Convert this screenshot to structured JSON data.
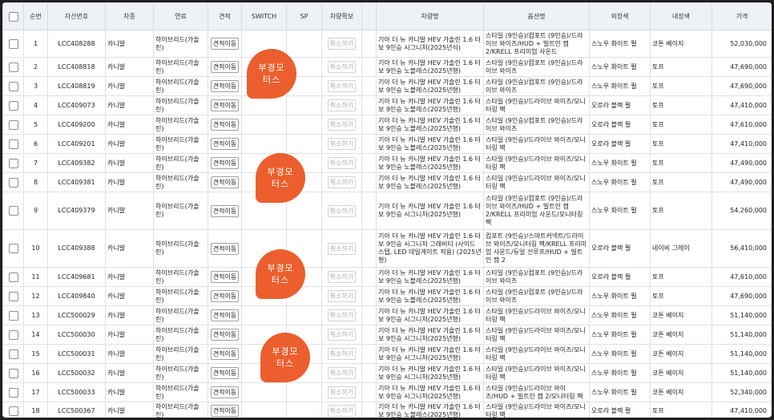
{
  "headers": [
    "",
    "순번",
    "자산번호",
    "차종",
    "연료",
    "견적",
    "SWITCH",
    "SP",
    "차량확보",
    "",
    "차량명",
    "옵션명",
    "외장색",
    "내장색",
    "가격"
  ],
  "buttons": {
    "quote_move": "견적이동",
    "cancel": "취소하기"
  },
  "badge": {
    "line1": "부경모",
    "line2": "터스"
  },
  "rows": [
    {
      "no": "1",
      "asset": "LCC408288",
      "model": "카니발",
      "fuel": "하이브리드(가솔린)",
      "name": "기아 더 뉴 카니발 HEV 가솔린 1.6 터보 9인승 시그니처(2025년식)",
      "option": "스타일 (9인승)/컴포트 (9인승)/드라이브 와이즈/HUD + 빌트인 캠 2/KRELL 프리미엄 사운드",
      "ext": "스노우 화이트 펄",
      "int": "코튼 베이지",
      "price": "52,030,000",
      "h": 34
    },
    {
      "no": "2",
      "asset": "LCC408818",
      "model": "카니발",
      "fuel": "하이브리드(가솔린)",
      "name": "기아 더 뉴 카니발 HEV 가솔린 1.6 터보 9인승 노블레스(2025년형)",
      "option": "스타일 (9인승)/컴포트 (9인승)/드라이브 와이즈",
      "ext": "스노우 화이트 펄",
      "int": "토프",
      "price": "47,690,000",
      "h": 24
    },
    {
      "no": "3",
      "asset": "LCC408819",
      "model": "카니발",
      "fuel": "하이브리드(가솔린)",
      "name": "기아 더 뉴 카니발 HEV 가솔린 1.6 터보 9인승 노블레스(2025년형)",
      "option": "스타일 (9인승)/컴포트 (9인승)/드라이브 와이즈",
      "ext": "스노우 화이트 펄",
      "int": "토프",
      "price": "47,690,000",
      "h": 24
    },
    {
      "no": "4",
      "asset": "LCC409073",
      "model": "카니발",
      "fuel": "하이브리드(가솔린)",
      "name": "기아 더 뉴 카니발 HEV 가솔린 1.6 터보 9인승 노블레스(2025년형)",
      "option": "스타일 (9인승)/드라이브 와이즈/모니터링 팩",
      "ext": "오로라 블랙 펄",
      "int": "토프",
      "price": "47,410,000",
      "h": 24
    },
    {
      "no": "5",
      "asset": "LCC409200",
      "model": "카니발",
      "fuel": "하이브리드(가솔린)",
      "name": "기아 더 뉴 카니발 HEV 가솔린 1.6 터보 9인승 노블레스(2025년형)",
      "option": "스타일 (9인승)/컴포트 (9인승)/드라이브 와이즈",
      "ext": "오로라 블랙 펄",
      "int": "토프",
      "price": "47,610,000",
      "h": 24
    },
    {
      "no": "6",
      "asset": "LCC409201",
      "model": "카니발",
      "fuel": "하이브리드(가솔린)",
      "name": "기아 더 뉴 카니발 HEV 가솔린 1.6 터보 9인승 노블레스(2025년형)",
      "option": "스타일 (9인승)/드라이브 와이즈/모니터링 팩",
      "ext": "오로라 블랙 펄",
      "int": "토프",
      "price": "47,410,000",
      "h": 24
    },
    {
      "no": "7",
      "asset": "LCC409382",
      "model": "카니발",
      "fuel": "하이브리드(가솔린)",
      "name": "기아 더 뉴 카니발 HEV 가솔린 1.6 터보 9인승 노블레스(2025년형)",
      "option": "스타일 (9인승)/드라이브 와이즈/모니터링 팩",
      "ext": "스노우 화이트 펄",
      "int": "토프",
      "price": "47,490,000",
      "h": 24
    },
    {
      "no": "8",
      "asset": "LCC409381",
      "model": "카니발",
      "fuel": "하이브리드(가솔린)",
      "name": "기아 더 뉴 카니발 HEV 가솔린 1.6 터보 9인승 노블레스(2025년형)",
      "option": "스타일 (9인승)/드라이브 와이즈/모니터링 팩",
      "ext": "스노우 화이트 펄",
      "int": "토프",
      "price": "47,490,000",
      "h": 24
    },
    {
      "no": "9",
      "asset": "LCC409379",
      "model": "카니발",
      "fuel": "하이브리드(가솔린)",
      "name": "기아 더 뉴 카니발 HEV 가솔린 1.6 터보 9인승 시그니처(2025년형)",
      "option": "스타일 (9인승)/컴포트 (9인승)/드라이브 와이즈/HUD + 빌트인 캠 2/KRELL 프리미엄 사운드/모니터링 팩",
      "ext": "스노우 화이트 펄",
      "int": "토프",
      "price": "54,260,000",
      "h": 47
    },
    {
      "no": "10",
      "asset": "LCC409388",
      "model": "카니발",
      "fuel": "하이브리드(가솔린)",
      "name": "기아 더 뉴 카니발 HEV 가솔린 1.6 터보 9인승 시그니처 그래비티 (사이드 스텝, LED 데일게이트 적용) (2025년형)",
      "option": "컴포트 (9인승)/스마트커넥트/드라이브 와이즈/모니터링 팩/KRELL 프리미엄 사운드/듀얼 선루프/HUD + 빌트인 캠 2",
      "ext": "오로라 블랙 펄",
      "int": "네이비 그레이",
      "price": "56,410,000",
      "h": 47
    },
    {
      "no": "11",
      "asset": "LCC409681",
      "model": "카니발",
      "fuel": "하이브리드(가솔린)",
      "name": "기아 더 뉴 카니발 HEV 가솔린 1.6 터보 9인승 노블레스(2025년형)",
      "option": "스타일 (9인승)/컴포트 (9인승)/드라이브 와이즈",
      "ext": "오로라 블랙 펄",
      "int": "토프",
      "price": "47,610,000",
      "h": 24
    },
    {
      "no": "12",
      "asset": "LCC409840",
      "model": "카니발",
      "fuel": "하이브리드(가솔린)",
      "name": "기아 더 뉴 카니발 HEV 가솔린 1.6 터보 9인승 노블레스(2025년형)",
      "option": "스타일 (9인승)/컴포트 (9인승)/드라이브 와이즈",
      "ext": "스노우 화이트 펄",
      "int": "토프",
      "price": "47,690,000",
      "h": 24
    },
    {
      "no": "13",
      "asset": "LCC500029",
      "model": "카니발",
      "fuel": "하이브리드(가솔린)",
      "name": "기아 더 뉴 카니발 HEV 가솔린 1.6 터보 9인승 시그니처(2025년형)",
      "option": "스타일 (9인승)/드라이브 와이즈/모니터링 팩",
      "ext": "스노우 화이트 펄",
      "int": "코튼 베이지",
      "price": "51,140,000",
      "h": 24
    },
    {
      "no": "14",
      "asset": "LCC500030",
      "model": "카니발",
      "fuel": "하이브리드(가솔린)",
      "name": "기아 더 뉴 카니발 HEV 가솔린 1.6 터보 9인승 시그니처(2025년형)",
      "option": "스타일 (9인승)/드라이브 와이즈/모니터링 팩",
      "ext": "스노우 화이트 펄",
      "int": "코튼 베이지",
      "price": "51,140,000",
      "h": 24
    },
    {
      "no": "15",
      "asset": "LCC500031",
      "model": "카니발",
      "fuel": "하이브리드(가솔린)",
      "name": "기아 더 뉴 카니발 HEV 가솔린 1.6 터보 9인승 시그니처(2025년형)",
      "option": "스타일 (9인승)/드라이브 와이즈/모니터링 팩",
      "ext": "스노우 화이트 펄",
      "int": "코튼 베이지",
      "price": "51,140,000",
      "h": 24
    },
    {
      "no": "16",
      "asset": "LCC500032",
      "model": "카니발",
      "fuel": "하이브리드(가솔린)",
      "name": "기아 더 뉴 카니발 HEV 가솔린 1.6 터보 9인승 시그니처(2025년형)",
      "option": "스타일 (9인승)/드라이브 와이즈/모니터링 팩",
      "ext": "스노우 화이트 펄",
      "int": "코튼 베이지",
      "price": "51,140,000",
      "h": 24
    },
    {
      "no": "17",
      "asset": "LCC500033",
      "model": "카니발",
      "fuel": "하이브리드(가솔린)",
      "name": "기아 더 뉴 카니발 HEV 가솔린 1.6 터보 9인승 시그니처(2025년형)",
      "option": "스타일 (9인승)/드라이브 와이즈/HUD + 빌트인 캠 2/모니터링 팩",
      "ext": "스노우 화이트 펄",
      "int": "코튼 베이지",
      "price": "52,340,000",
      "h": 24
    },
    {
      "no": "18",
      "asset": "LCC500367",
      "model": "카니발",
      "fuel": "하이브리드(가솔린)",
      "name": "기아 더 뉴 카니발 HEV 가솔린 1.6 터보 9인승 노블레스(2025년형)",
      "option": "스타일 (9인승)/드라이브 와이즈/모니터링 팩",
      "ext": "오로라 블랙 펄",
      "int": "토프",
      "price": "47,410,000",
      "h": 22
    }
  ]
}
